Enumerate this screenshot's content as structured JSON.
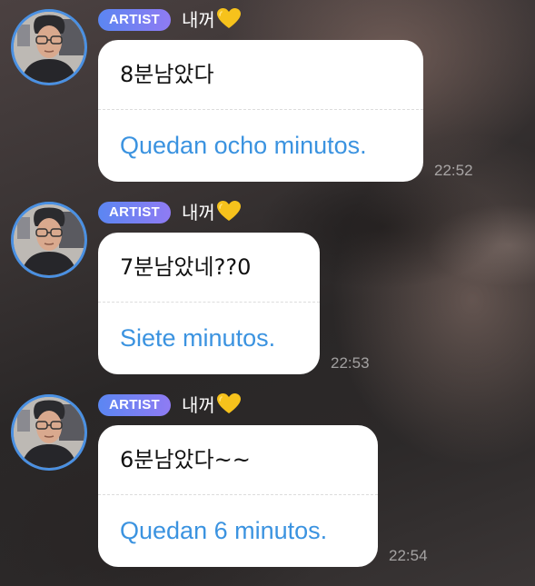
{
  "messages": [
    {
      "badge": "ARTIST",
      "sender": "내꺼",
      "sender_icon": "yellow-heart-icon",
      "original": "8분남았다",
      "translation": "Quedan ocho minutos.",
      "time": "22:52"
    },
    {
      "badge": "ARTIST",
      "sender": "내꺼",
      "sender_icon": "yellow-heart-icon",
      "original": "7분남았네??0",
      "translation": "Siete minutos.",
      "time": "22:53"
    },
    {
      "badge": "ARTIST",
      "sender": "내꺼",
      "sender_icon": "yellow-heart-icon",
      "original": "6분남았다~~",
      "translation": "Quedan 6 minutos.",
      "time": "22:54"
    }
  ],
  "colors": {
    "badge_start": "#5b86f2",
    "badge_end": "#8f7bf3",
    "avatar_ring": "#4a90e2",
    "translation_text": "#3b93e0",
    "heart": "#f6c21c"
  }
}
